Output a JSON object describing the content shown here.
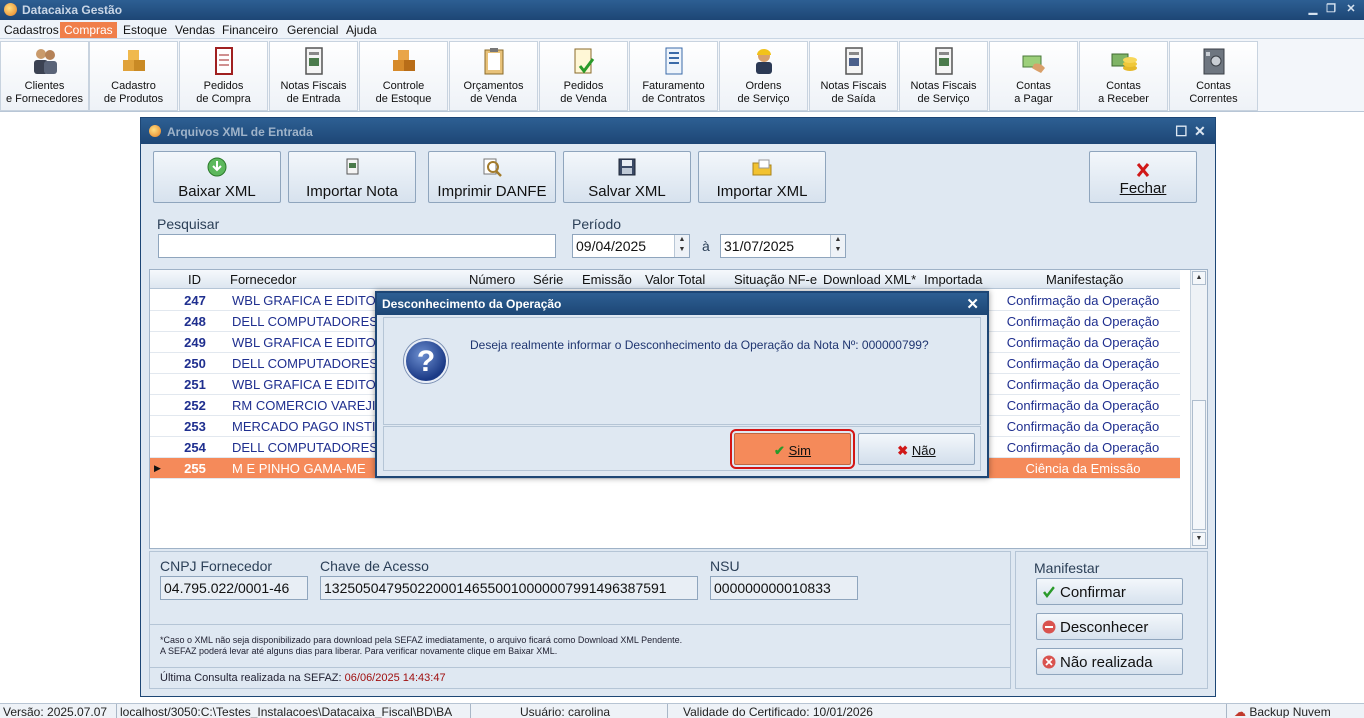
{
  "app": {
    "title": "Datacaixa Gestão"
  },
  "menu": [
    "Cadastros",
    "Compras",
    "Estoque",
    "Vendas",
    "Financeiro",
    "Gerencial",
    "Ajuda"
  ],
  "menu_active": "Compras",
  "ribbon": [
    {
      "label": "Clientes\ne Fornecedores",
      "icon": "clients-icon"
    },
    {
      "label": "Cadastro\nde Produtos",
      "icon": "products-icon"
    },
    {
      "label": "Pedidos\nde Compra",
      "icon": "purchase-orders-icon"
    },
    {
      "label": "Notas Fiscais\nde Entrada",
      "icon": "entry-invoices-icon"
    },
    {
      "label": "Controle\nde Estoque",
      "icon": "stock-control-icon"
    },
    {
      "label": "Orçamentos\nde Venda",
      "icon": "sales-quotes-icon"
    },
    {
      "label": "Pedidos\nde Venda",
      "icon": "sales-orders-icon"
    },
    {
      "label": "Faturamento\nde Contratos",
      "icon": "contract-billing-icon"
    },
    {
      "label": "Ordens\nde Serviço",
      "icon": "service-orders-icon"
    },
    {
      "label": "Notas Fiscais\nde Saída",
      "icon": "exit-invoices-icon"
    },
    {
      "label": "Notas Fiscais\nde Serviço",
      "icon": "service-invoices-icon"
    },
    {
      "label": "Contas\na Pagar",
      "icon": "payables-icon"
    },
    {
      "label": "Contas\na Receber",
      "icon": "receivables-icon"
    },
    {
      "label": "Contas\nCorrentes",
      "icon": "checking-accounts-icon"
    }
  ],
  "xml_window": {
    "title": "Arquivos XML de Entrada",
    "buttons": {
      "baixar": "Baixar XML",
      "importar_nota": "Importar Nota",
      "imprimir": "Imprimir DANFE",
      "salvar": "Salvar XML",
      "importar_xml": "Importar XML",
      "fechar": "Fechar"
    },
    "search": {
      "label": "Pesquisar",
      "value": ""
    },
    "period": {
      "label": "Período",
      "from": "09/04/2025",
      "sep": "à",
      "to": "31/07/2025"
    },
    "columns": [
      "ID",
      "Fornecedor",
      "Número",
      "Série",
      "Emissão",
      "Valor Total",
      "Situação NF-e",
      "Download XML*",
      "Importada",
      "Manifestação"
    ],
    "rows": [
      {
        "id": "247",
        "fornecedor": "WBL GRAFICA E EDITORA",
        "manifestacao": "Confirmação da Operação"
      },
      {
        "id": "248",
        "fornecedor": "DELL COMPUTADORES DO",
        "manifestacao": "Confirmação da Operação"
      },
      {
        "id": "249",
        "fornecedor": "WBL GRAFICA E EDITORA",
        "manifestacao": "Confirmação da Operação"
      },
      {
        "id": "250",
        "fornecedor": "DELL COMPUTADORES DO",
        "manifestacao": "Confirmação da Operação"
      },
      {
        "id": "251",
        "fornecedor": "WBL GRAFICA E EDITORA",
        "manifestacao": "Confirmação da Operação"
      },
      {
        "id": "252",
        "fornecedor": "RM COMERCIO VAREJISTA",
        "manifestacao": "Confirmação da Operação"
      },
      {
        "id": "253",
        "fornecedor": "MERCADO PAGO INSTITU",
        "manifestacao": "Confirmação da Operação"
      },
      {
        "id": "254",
        "fornecedor": "DELL COMPUTADORES DO",
        "manifestacao": "Confirmação da Operação"
      },
      {
        "id": "255",
        "fornecedor": "M E PINHO GAMA-ME",
        "manifestacao": "Ciência da Emissão"
      }
    ],
    "info": {
      "cnpj_label": "CNPJ Fornecedor",
      "cnpj": "04.795.022/0001-46",
      "chave_label": "Chave de Acesso",
      "chave": "13250504795022000146550010000007991496387591",
      "nsu_label": "NSU",
      "nsu": "000000000010833",
      "note1": "*Caso o XML não seja disponibilizado para download pela SEFAZ imediatamente, o arquivo ficará como Download XML Pendente.",
      "note2": "A SEFAZ poderá levar até alguns dias para liberar. Para verificar novamente clique em Baixar XML.",
      "last_label": "Última Consulta realizada na SEFAZ:",
      "last_value": "06/06/2025 14:43:47"
    },
    "manifestar": {
      "label": "Manifestar",
      "confirmar": "Confirmar",
      "desconhecer": "Desconhecer",
      "nao_realizada": "Não realizada"
    }
  },
  "dialog": {
    "title": "Desconhecimento da Operação",
    "message": "Deseja realmente informar o Desconhecimento da Operação da Nota Nº: 000000799?",
    "sim": "Sim",
    "nao": "Não"
  },
  "status": {
    "versao": "Versão: 2025.07.07",
    "db": "localhost/3050:C:\\Testes_Instalacoes\\Datacaixa_Fiscal\\BD\\BA",
    "usuario": "Usuário: carolina",
    "validade": "Validade do Certificado: 10/01/2026",
    "backup": "Backup Nuvem"
  },
  "colors": {
    "accent": "#f58a5a",
    "titlebar": "#1d4675",
    "panel": "#dfe8f2",
    "highlight": "#d41515"
  }
}
